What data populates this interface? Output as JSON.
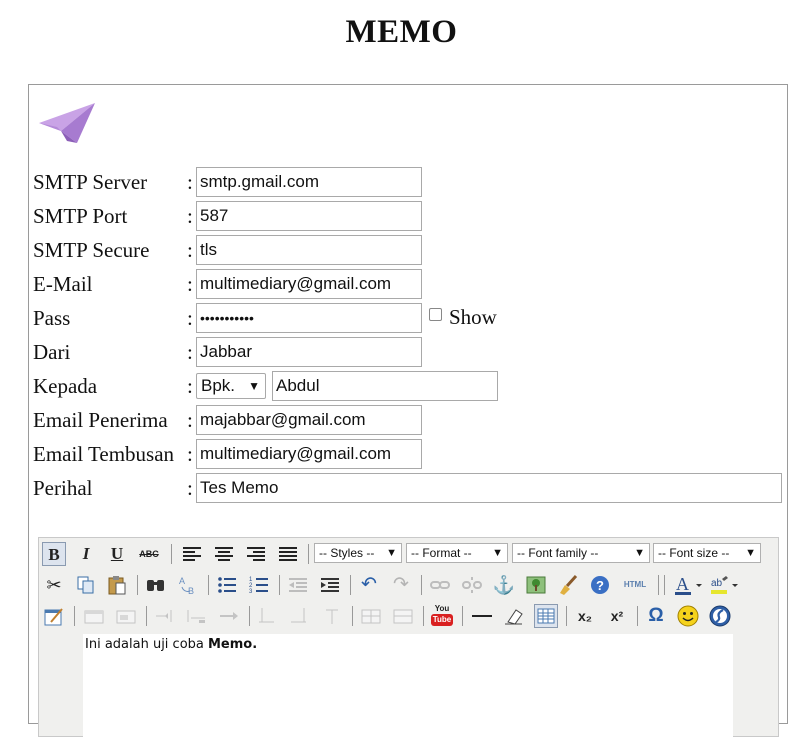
{
  "title": "MEMO",
  "form": {
    "smtp_server": {
      "label": "SMTP Server",
      "colon": ":",
      "value": "smtp.gmail.com"
    },
    "smtp_port": {
      "label": "SMTP Port",
      "colon": ":",
      "value": "587"
    },
    "smtp_secure": {
      "label": "SMTP Secure",
      "colon": ":",
      "value": "tls"
    },
    "email": {
      "label": "E-Mail",
      "colon": ":",
      "value": "multimediary@gmail.com"
    },
    "pass": {
      "label": "Pass",
      "colon": ":",
      "value": "•••••••••••",
      "show_label": "Show"
    },
    "dari": {
      "label": "Dari",
      "colon": ":",
      "value": "Jabbar"
    },
    "kepada": {
      "label": "Kepada",
      "colon": ":",
      "title_selected": "Bpk.",
      "value": "Abdul"
    },
    "email_penerima": {
      "label": "Email Penerima",
      "colon": ":",
      "value": "majabbar@gmail.com"
    },
    "email_tembusan": {
      "label": "Email Tembusan",
      "colon": ":",
      "value": "multimediary@gmail.com"
    },
    "perihal": {
      "label": "Perihal",
      "colon": ":",
      "value": "Tes Memo"
    }
  },
  "editor": {
    "toolbar": {
      "bold": "B",
      "italic": "I",
      "underline": "U",
      "strikethrough": "ABC",
      "styles": "-- Styles --",
      "format": "-- Format --",
      "font_family": "-- Font family --",
      "font_size": "-- Font size --",
      "dropdown_arrow": "▼",
      "youtube_top": "You",
      "youtube_bottom": "Tube",
      "html": "HTML",
      "subscript": "x₂",
      "superscript": "x²",
      "omega": "Ω"
    },
    "content_plain": "Ini adalah uji coba ",
    "content_bold": "Memo."
  }
}
